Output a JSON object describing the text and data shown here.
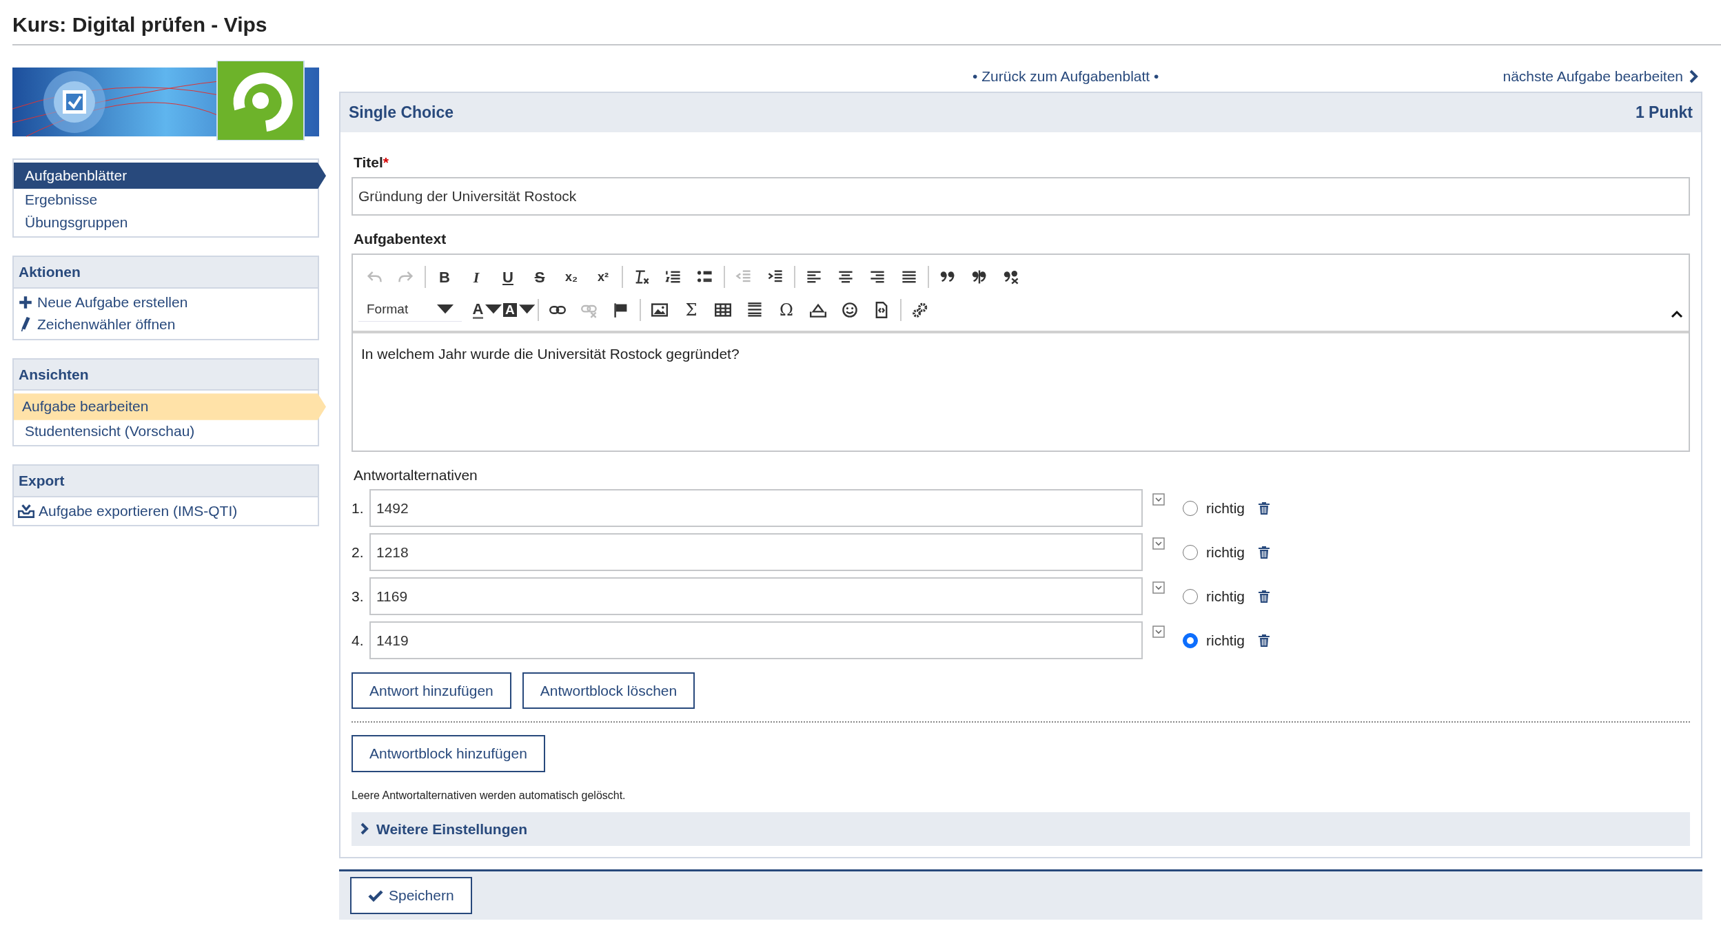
{
  "page_title": "Kurs: Digital prüfen - Vips",
  "sidebar": {
    "sections": [
      {
        "items": [
          {
            "label": "Aufgabenblätter",
            "selected": true
          },
          {
            "label": "Ergebnisse",
            "selected": false
          },
          {
            "label": "Übungsgruppen",
            "selected": false
          }
        ]
      },
      {
        "title": "Aktionen",
        "items": [
          {
            "label": "Neue Aufgabe erstellen",
            "kind": "plus"
          },
          {
            "label": "Zeichenwähler öffnen",
            "kind": "pencil"
          }
        ]
      },
      {
        "title": "Ansichten",
        "items": [
          {
            "label": "Aufgabe bearbeiten",
            "selected": true
          },
          {
            "label": "Studentensicht (Vorschau)",
            "selected": false
          }
        ]
      },
      {
        "title": "Export",
        "items": [
          {
            "label": "Aufgabe exportieren (IMS-QTI)",
            "kind": "export"
          }
        ]
      }
    ]
  },
  "top_nav": {
    "back_link": "• Zurück zum Aufgabenblatt •",
    "next_link": "nächste Aufgabe bearbeiten"
  },
  "panel": {
    "title": "Single Choice",
    "points": "1 Punkt"
  },
  "title_field": {
    "label": "Titel",
    "required_mark": "*",
    "value": "Gründung der Universität Rostock"
  },
  "editor": {
    "label": "Aufgabentext",
    "toolbar": [
      [
        {
          "kind": "undo",
          "disabled": true
        },
        {
          "kind": "redo",
          "disabled": true
        },
        {
          "kind": "separator"
        },
        {
          "kind": "bold",
          "label": "B",
          "disabled": false
        },
        {
          "kind": "italic",
          "label": "I",
          "disabled": false
        },
        {
          "kind": "underline",
          "label": "U",
          "disabled": false
        },
        {
          "kind": "strike",
          "label": "S",
          "disabled": false
        },
        {
          "kind": "sub",
          "label": "x₂",
          "disabled": false
        },
        {
          "kind": "sup",
          "label": "x²",
          "disabled": false
        },
        {
          "kind": "separator"
        },
        {
          "kind": "clear-format",
          "disabled": false
        },
        {
          "kind": "numbered-list",
          "disabled": false
        },
        {
          "kind": "bullet-list",
          "disabled": false
        },
        {
          "kind": "separator"
        },
        {
          "kind": "outdent",
          "disabled": true
        },
        {
          "kind": "indent",
          "disabled": false
        },
        {
          "kind": "separator"
        },
        {
          "kind": "align-left",
          "disabled": false
        },
        {
          "kind": "align-center",
          "disabled": false
        },
        {
          "kind": "align-right",
          "disabled": false
        },
        {
          "kind": "align-justify",
          "disabled": false
        },
        {
          "kind": "separator"
        },
        {
          "kind": "quote",
          "disabled": false
        },
        {
          "kind": "quote-split",
          "disabled": false
        },
        {
          "kind": "quote-remove",
          "disabled": false
        }
      ],
      [
        {
          "kind": "format",
          "label": "Format",
          "disabled": false
        },
        {
          "kind": "text-color",
          "label": "A",
          "disabled": false
        },
        {
          "kind": "bg-color",
          "label": "A",
          "disabled": false
        },
        {
          "kind": "separator"
        },
        {
          "kind": "link",
          "disabled": false
        },
        {
          "kind": "unlink",
          "disabled": true
        },
        {
          "kind": "flag",
          "disabled": false
        },
        {
          "kind": "separator"
        },
        {
          "kind": "image",
          "disabled": false
        },
        {
          "kind": "glyph",
          "label": "Σ",
          "disabled": false
        },
        {
          "kind": "table",
          "disabled": false
        },
        {
          "kind": "hr",
          "disabled": false
        },
        {
          "kind": "glyph",
          "label": "Ω",
          "disabled": false
        },
        {
          "kind": "eject",
          "disabled": false
        },
        {
          "kind": "smiley",
          "disabled": false
        },
        {
          "kind": "source",
          "disabled": false
        },
        {
          "kind": "separator"
        },
        {
          "kind": "gears",
          "disabled": false
        }
      ]
    ],
    "content": "In welchem Jahr wurde die Universität Rostock gegründet?"
  },
  "answers": {
    "label": "Antwortalternativen",
    "items": [
      {
        "number": "1.",
        "value": "1492",
        "correct_label": "richtig",
        "selected": false
      },
      {
        "number": "2.",
        "value": "1218",
        "correct_label": "richtig",
        "selected": false
      },
      {
        "number": "3.",
        "value": "1169",
        "correct_label": "richtig",
        "selected": false
      },
      {
        "number": "4.",
        "value": "1419",
        "correct_label": "richtig",
        "selected": true
      }
    ]
  },
  "buttons": [
    "Antwort hinzufügen",
    "Antwortblock löschen"
  ],
  "add_block_button": "Antwortblock hinzufügen",
  "note": "Leere Antwortalternativen werden automatisch gelöscht.",
  "more_settings": {
    "label": "Weitere Einstellungen",
    "expanded": false
  },
  "save_button": "Speichern"
}
